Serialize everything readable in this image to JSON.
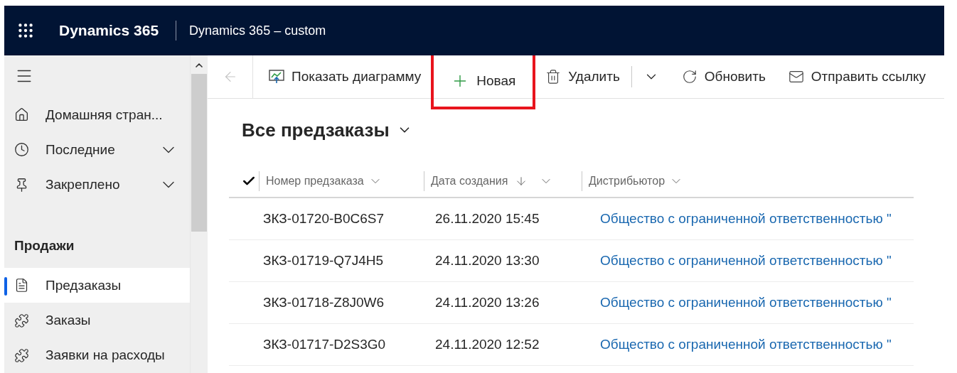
{
  "header": {
    "app_name": "Dynamics 365",
    "environment": "Dynamics 365 – custom"
  },
  "sidebar": {
    "items": [
      {
        "label": "Домашняя стран...",
        "kind": "link"
      },
      {
        "label": "Последние",
        "kind": "group",
        "expanded": false
      },
      {
        "label": "Закреплено",
        "kind": "group",
        "expanded": false
      }
    ],
    "section": "Продажи",
    "section_items": [
      {
        "label": "Предзаказы",
        "selected": true
      },
      {
        "label": "Заказы",
        "selected": false
      },
      {
        "label": "Заявки на расходы",
        "selected": false
      }
    ]
  },
  "command_bar": {
    "back_disabled": true,
    "commands": [
      {
        "kind": "button",
        "label": "Показать диаграмму",
        "highlighted": false
      },
      {
        "kind": "button",
        "label": "Новая",
        "highlighted": true
      },
      {
        "kind": "button",
        "label": "Удалить",
        "highlighted": false
      },
      {
        "kind": "dropdown",
        "highlighted": false
      },
      {
        "kind": "button",
        "label": "Обновить",
        "highlighted": false
      },
      {
        "kind": "button",
        "label": "Отправить ссылку",
        "highlighted": false
      }
    ]
  },
  "view": {
    "title": "Все предзаказы"
  },
  "table": {
    "columns": [
      {
        "label": "Номер предзаказа",
        "sorted_descending": false
      },
      {
        "label": "Дата создания",
        "sorted_descending": true
      },
      {
        "label": "Дистрибьютор",
        "sorted_descending": false
      }
    ],
    "rows": [
      {
        "number": "ЗКЗ-01720-B0C6S7",
        "created": "26.11.2020 15:45",
        "distributor": "Общество с ограниченной ответственностью \""
      },
      {
        "number": "ЗКЗ-01719-Q7J4H5",
        "created": "24.11.2020 13:30",
        "distributor": "Общество с ограниченной ответственностью \""
      },
      {
        "number": "ЗКЗ-01718-Z8J0W6",
        "created": "24.11.2020 13:26",
        "distributor": "Общество с ограниченной ответственностью \""
      },
      {
        "number": "ЗКЗ-01717-D2S3G0",
        "created": "24.11.2020 12:52",
        "distributor": "Общество с ограниченной ответственностью \""
      }
    ]
  }
}
